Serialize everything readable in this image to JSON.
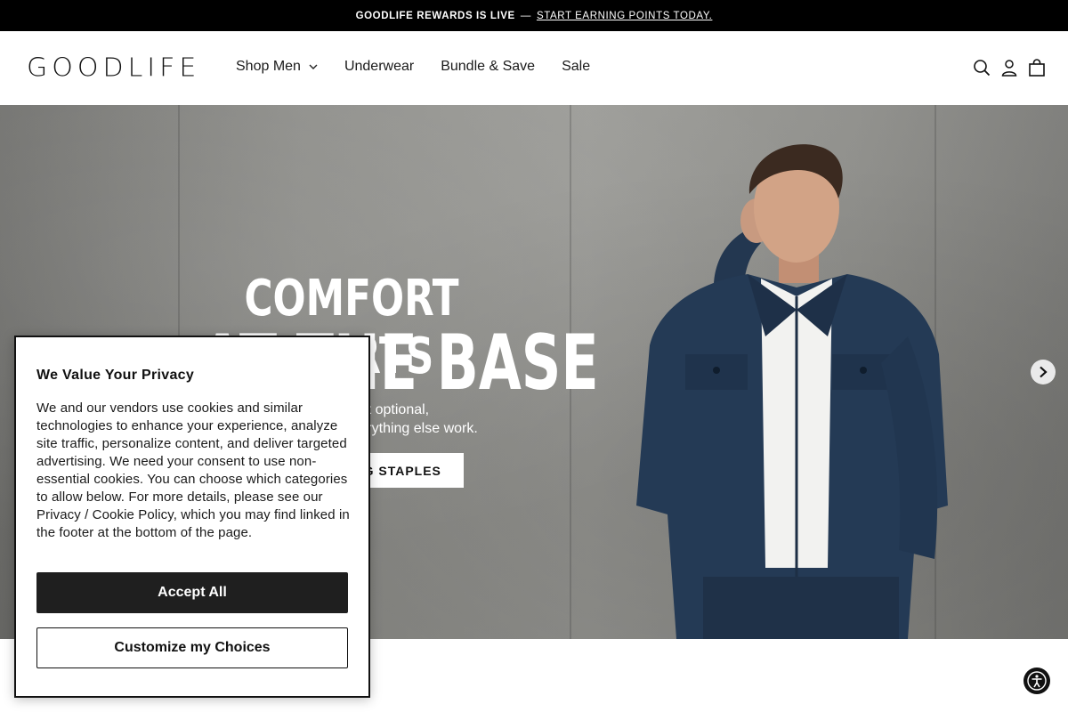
{
  "announcement": {
    "strong": "GOODLIFE REWARDS IS LIVE",
    "separator": "—",
    "link": "START EARNING POINTS TODAY."
  },
  "header": {
    "logo": "GOODLIFE",
    "nav": [
      {
        "label": "Shop Men",
        "has_dropdown": true
      },
      {
        "label": "Underwear"
      },
      {
        "label": "Bundle & Save"
      },
      {
        "label": "Sale"
      }
    ],
    "icons": [
      "search-icon",
      "account-icon",
      "cart-icon"
    ]
  },
  "hero": {
    "headline_line1": "COMFORT STARTS",
    "headline_line2": "AT THE BASE",
    "subtext_line1": "Comfort isn't optional,",
    "subtext_line2": "it's what makes everything else work.",
    "cta": "SHOP LAYERING STAPLES",
    "next_icon": "chevron-right-icon"
  },
  "cookie_banner": {
    "title": "We Value Your Privacy",
    "body": "We and our vendors use cookies and similar technologies to enhance your experience, analyze site traffic, personalize content, and deliver targeted advertising. We need your consent to use non-essential cookies. You can choose which categories to allow below. For more details, please see our Privacy / Cookie Policy, which you may find linked in the footer at the bottom of the page.",
    "accept_label": "Accept All",
    "customize_label": "Customize my Choices"
  },
  "accessibility": {
    "icon": "accessibility-icon"
  },
  "colors": {
    "announcement_bg": "#000000",
    "accept_bg": "#1f1f1f",
    "jacket": "#243a55"
  }
}
